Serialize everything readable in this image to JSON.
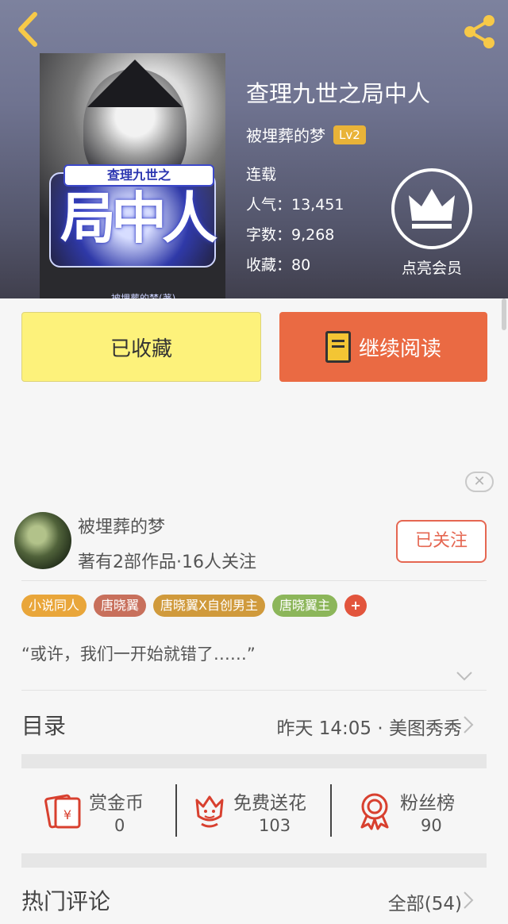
{
  "book": {
    "title": "查理九世之局中人",
    "author": "被埋葬的梦",
    "level": "Lv2",
    "status": "连载",
    "popularity": "人气：13,451",
    "word_count": "字数：9,268",
    "favorites": "收藏：80",
    "cover": {
      "title": "查理九世之",
      "big": "局中人",
      "author": "被埋葬的梦(著)"
    }
  },
  "vip": {
    "label": "点亮会员"
  },
  "actions": {
    "collect": "已收藏",
    "read": "继续阅读"
  },
  "close_ad": "✕",
  "author_card": {
    "name": "被埋葬的梦",
    "meta": "著有2部作品·16人关注",
    "follow": "已关注"
  },
  "tags": [
    {
      "label": "小说同人",
      "color": "#e9a63a"
    },
    {
      "label": "唐晓翼",
      "color": "#c8705c"
    },
    {
      "label": "唐晓翼X自创男主",
      "color": "#d09a3c"
    },
    {
      "label": "唐晓翼主",
      "color": "#8cb65a"
    },
    {
      "label": "+",
      "color": "#e2553d"
    }
  ],
  "quote": "“或许，我们一开始就错了……”",
  "catalog": {
    "title": "目录",
    "update": "昨天 14:05 · 美图秀秀"
  },
  "rewards": [
    {
      "label": "赏金币",
      "value": "0",
      "icon": "red-envelope-icon"
    },
    {
      "label": "免费送花",
      "value": "103",
      "icon": "flower-icon"
    },
    {
      "label": "粉丝榜",
      "value": "90",
      "icon": "medal-icon"
    }
  ],
  "comments": {
    "title": "热门评论",
    "all": "全部(54)"
  },
  "colors": {
    "accent": "#ea6a43",
    "collect_bg": "#fdf27b",
    "icon_red": "#d8402f"
  }
}
